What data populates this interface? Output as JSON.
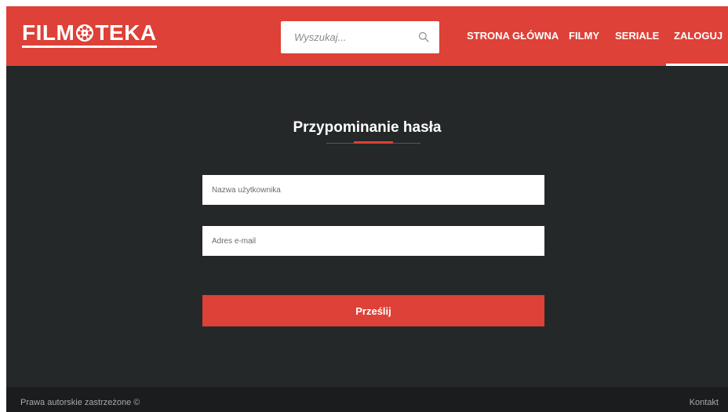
{
  "header": {
    "logo_left": "FILM",
    "logo_icon": "film-reel-icon",
    "logo_right": "TEKA",
    "search": {
      "placeholder": "Wyszukaj...",
      "icon": "search-icon"
    },
    "nav": [
      {
        "label": "STRONA GŁÓWNA"
      },
      {
        "label": "FILMY"
      },
      {
        "label": "SERIALE"
      },
      {
        "label": "ZALOGUJ",
        "active": true
      }
    ]
  },
  "main": {
    "title": "Przypominanie hasła",
    "form": {
      "username_placeholder": "Nazwa użytkownika",
      "email_placeholder": "Adres e-mail",
      "submit_label": "Prześlij"
    }
  },
  "footer": {
    "copyright": "Prawa autorskie zastrzeżone ©",
    "contact": "Kontakt"
  },
  "colors": {
    "accent": "#dd4137",
    "background": "#252829",
    "footer": "#1a1c1d"
  }
}
